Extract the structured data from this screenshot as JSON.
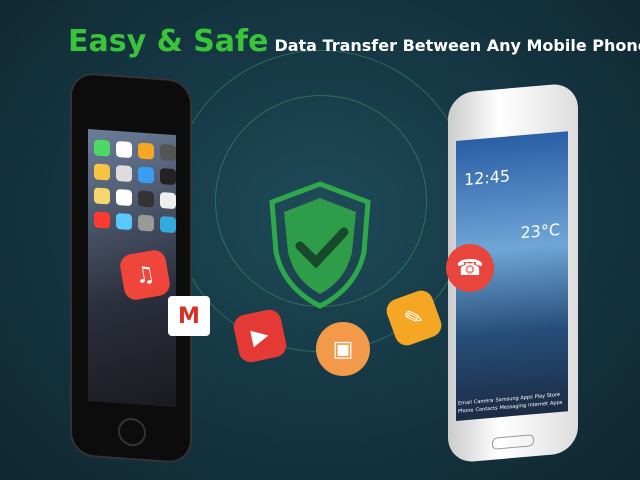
{
  "headline": {
    "emphasis": "Easy & Safe",
    "rest": "Data Transfer Between Any Mobile Phones"
  },
  "phone_right": {
    "time": "12:45",
    "temperature": "23°C",
    "apps": [
      "Email",
      "Camera",
      "Samsung Apps",
      "Play Store",
      "Phone",
      "Contacts",
      "Messaging",
      "Internet",
      "Apps"
    ]
  },
  "colors": {
    "accent": "#39c43a",
    "background": "#163845"
  },
  "icons": [
    "shield-check-icon",
    "music-icon",
    "gmail-icon",
    "youtube-icon",
    "photo-icon",
    "notes-icon",
    "contacts-icon"
  ]
}
